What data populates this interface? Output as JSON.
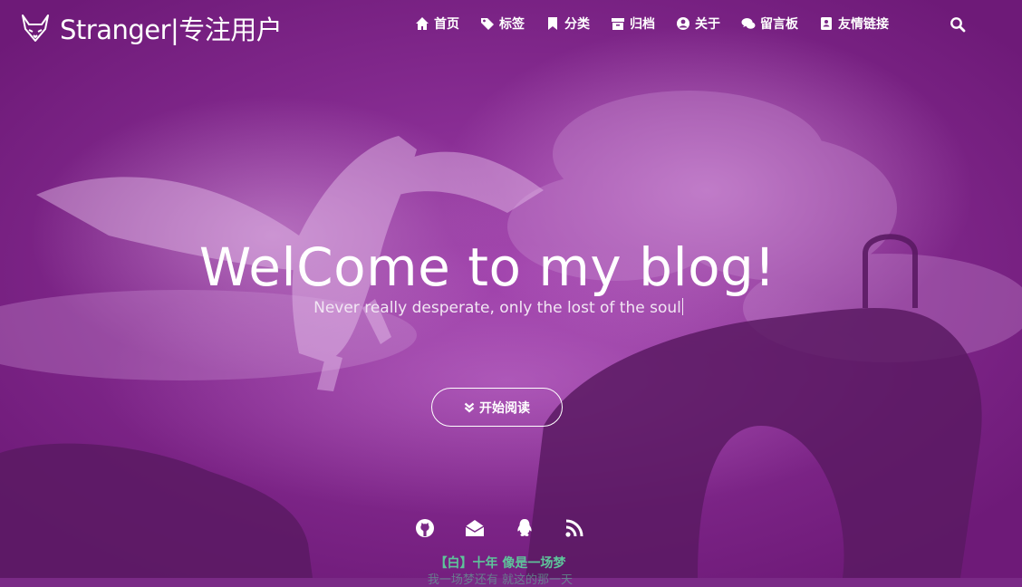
{
  "brand": {
    "name": "Stranger|专注用户",
    "logo_icon": "fox-icon"
  },
  "nav": {
    "items": [
      {
        "label": "首页",
        "icon": "home-icon"
      },
      {
        "label": "标签",
        "icon": "tags-icon"
      },
      {
        "label": "分类",
        "icon": "bookmark-icon"
      },
      {
        "label": "归档",
        "icon": "archive-icon"
      },
      {
        "label": "关于",
        "icon": "user-circle-icon"
      },
      {
        "label": "留言板",
        "icon": "comments-icon"
      },
      {
        "label": "友情链接",
        "icon": "address-book-icon"
      }
    ],
    "search_icon": "search-icon"
  },
  "hero": {
    "title": "WelCome to my blog!",
    "subtitle": "Never really desperate, only the lost of the soul",
    "start_button": "开始阅读"
  },
  "social": [
    "github-icon",
    "envelope-icon",
    "qq-icon",
    "rss-icon"
  ],
  "quote": {
    "text": "【白】十年 像是一场梦",
    "next_line": "我一场梦还有 就这的那一天"
  },
  "colors": {
    "overlay": "#7a2a86",
    "quote": "#5ec49a"
  }
}
